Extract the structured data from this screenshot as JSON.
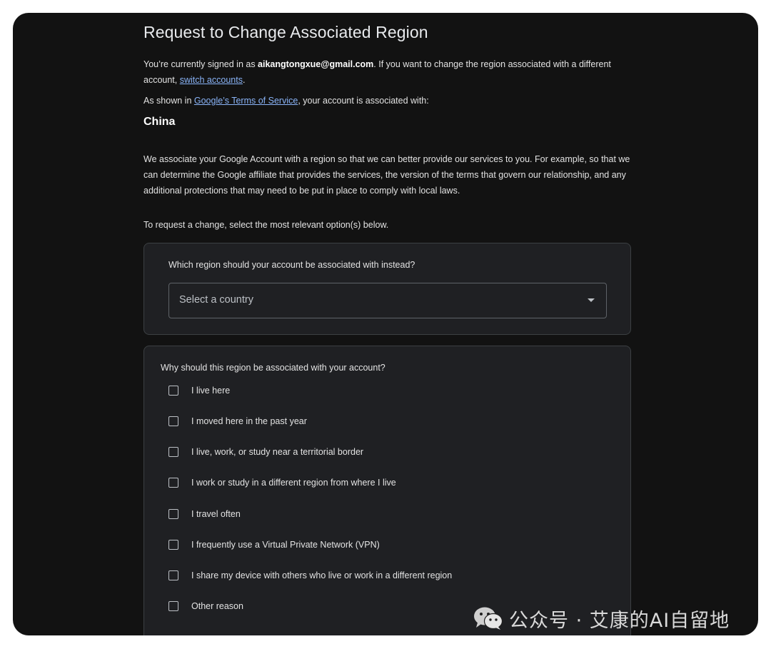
{
  "page": {
    "title": "Request to Change Associated Region"
  },
  "intro": {
    "signed_in_prefix": "You’re currently signed in as ",
    "email": "aikangtongxue@gmail.com",
    "signed_in_middle": ". If you want to change the region associated with a different account, ",
    "switch_link": "switch accounts",
    "signed_in_suffix": ".",
    "tos_prefix": "As shown in ",
    "tos_link": "Google’s Terms of Service",
    "tos_suffix": ", your account is associated with:",
    "region": "China",
    "explanation": "We associate your Google Account with a region so that we can better provide our services to you. For example, so that we can determine the Google affiliate that provides the services, the version of the terms that govern our relationship, and any additional protections that may need to be put in place to comply with local laws.",
    "instruction": "To request a change, select the most relevant option(s) below."
  },
  "region_card": {
    "question": "Which region should your account be associated with instead?",
    "select_placeholder": "Select a country"
  },
  "reason_card": {
    "question": "Why should this region be associated with your account?",
    "options": [
      {
        "label": "I live here",
        "checked": false
      },
      {
        "label": "I moved here in the past year",
        "checked": false
      },
      {
        "label": "I live, work, or study near a territorial border",
        "checked": false
      },
      {
        "label": "I work or study in a different region from where I live",
        "checked": false
      },
      {
        "label": "I travel often",
        "checked": false
      },
      {
        "label": "I frequently use a Virtual Private Network (VPN)",
        "checked": false
      },
      {
        "label": "I share my device with others who live or work in a different region",
        "checked": false
      },
      {
        "label": "Other reason",
        "checked": false
      }
    ]
  },
  "watermark": {
    "text": "公众号 · 艾康的AI自留地",
    "icon": "wechat-icon"
  },
  "colors": {
    "background": "#121212",
    "card": "#1f2023",
    "link": "#8ab4f8",
    "text": "#e3e3e3"
  }
}
